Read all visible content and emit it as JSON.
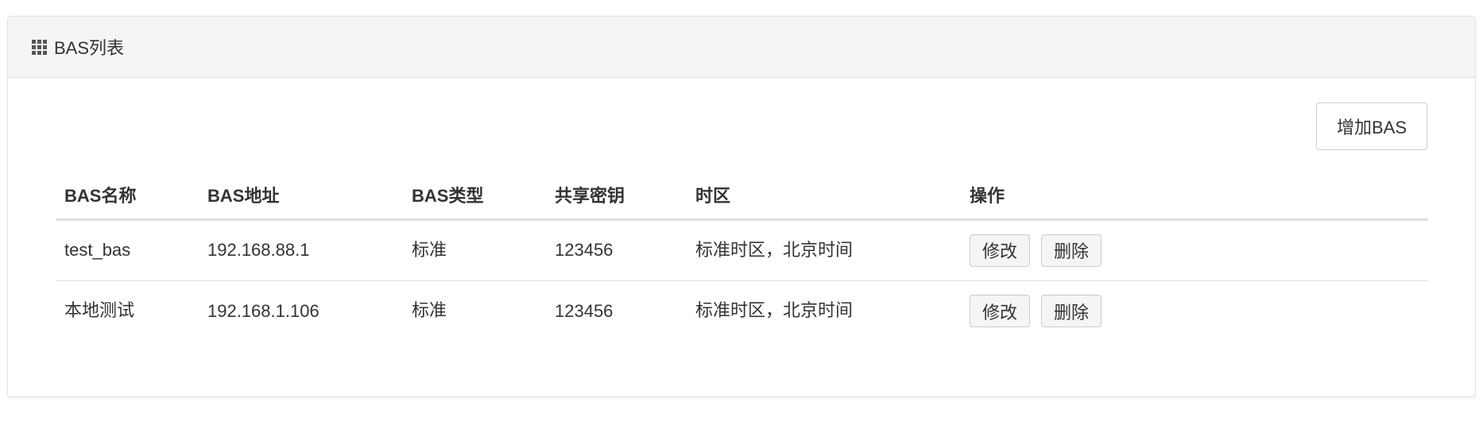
{
  "panel": {
    "title": "BAS列表",
    "icon": "grid-icon"
  },
  "toolbar": {
    "add_label": "增加BAS"
  },
  "table": {
    "columns": [
      "BAS名称",
      "BAS地址",
      "BAS类型",
      "共享密钥",
      "时区",
      "操作"
    ],
    "rows": [
      {
        "name": "test_bas",
        "address": "192.168.88.1",
        "type": "标准",
        "secret": "123456",
        "timezone": "标准时区，北京时间",
        "edit_label": "修改",
        "delete_label": "删除"
      },
      {
        "name": "本地测试",
        "address": "192.168.1.106",
        "type": "标准",
        "secret": "123456",
        "timezone": "标准时区，北京时间",
        "edit_label": "修改",
        "delete_label": "删除"
      }
    ]
  },
  "colors": {
    "heading_bg": "#f5f5f5",
    "border": "#dddddd",
    "text": "#333333",
    "button_bg": "#f5f5f5"
  }
}
